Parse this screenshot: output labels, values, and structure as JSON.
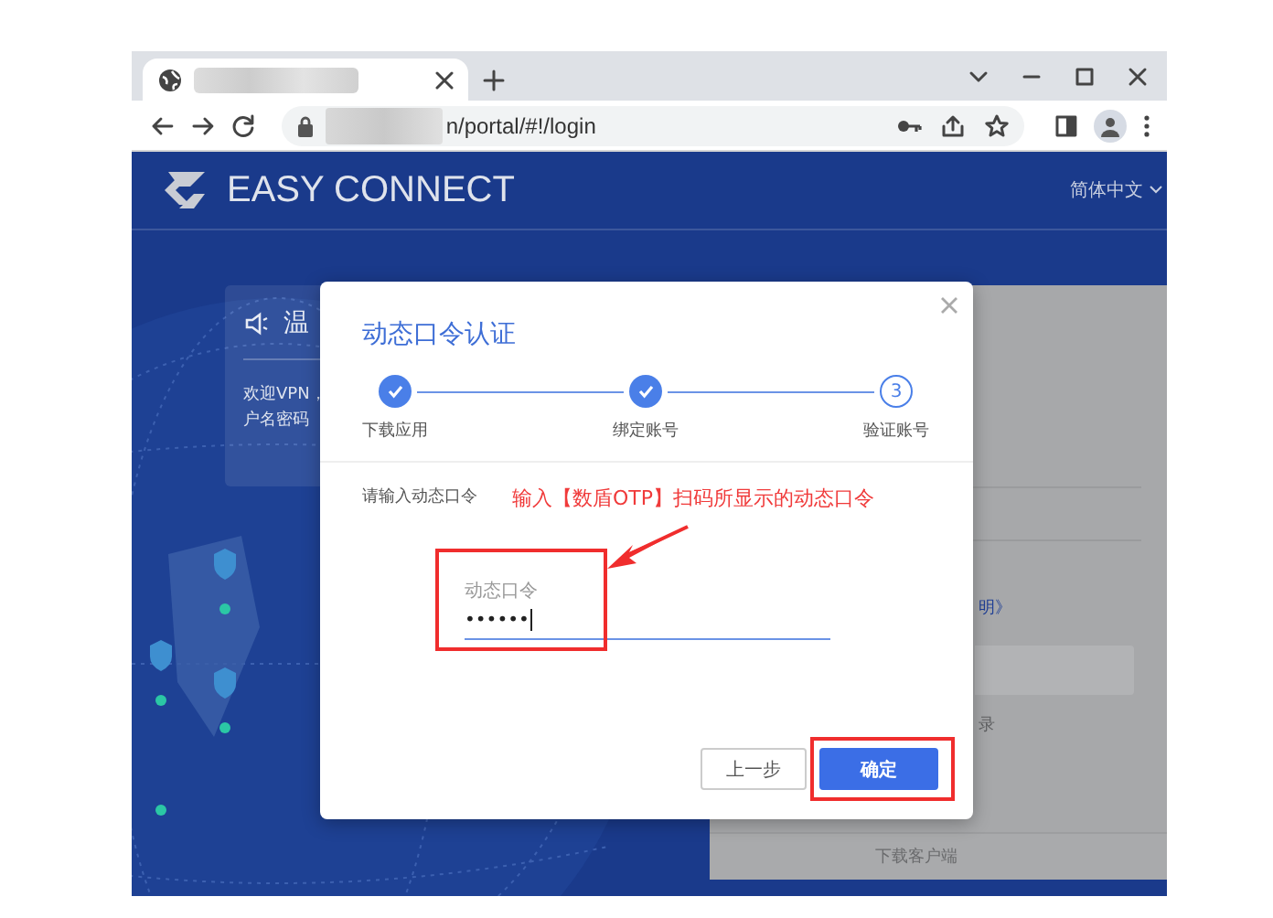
{
  "browser": {
    "address": "n/portal/#!/login"
  },
  "header": {
    "logo_text": "EASY CONNECT",
    "language": "简体中文"
  },
  "notice_card": {
    "title": "温",
    "lines": [
      "欢迎VPN，",
      "户名密码"
    ]
  },
  "login_panel": {
    "help_link": "明》",
    "hint": "录",
    "download_button": "下载客户端"
  },
  "dialog": {
    "title": "动态口令认证",
    "steps": [
      {
        "label": "下载应用",
        "done": true
      },
      {
        "label": "绑定账号",
        "done": true
      },
      {
        "label": "验证账号",
        "done": false,
        "number": "3"
      }
    ],
    "prompt": "请输入动态口令",
    "field": {
      "label": "动态口令",
      "value": "••••••"
    },
    "buttons": [
      {
        "label": "上一步",
        "kind": "secondary"
      },
      {
        "label": "确定",
        "kind": "primary"
      }
    ]
  },
  "annotation": {
    "text": "输入【数盾OTP】扫码所显示的动态口令"
  }
}
